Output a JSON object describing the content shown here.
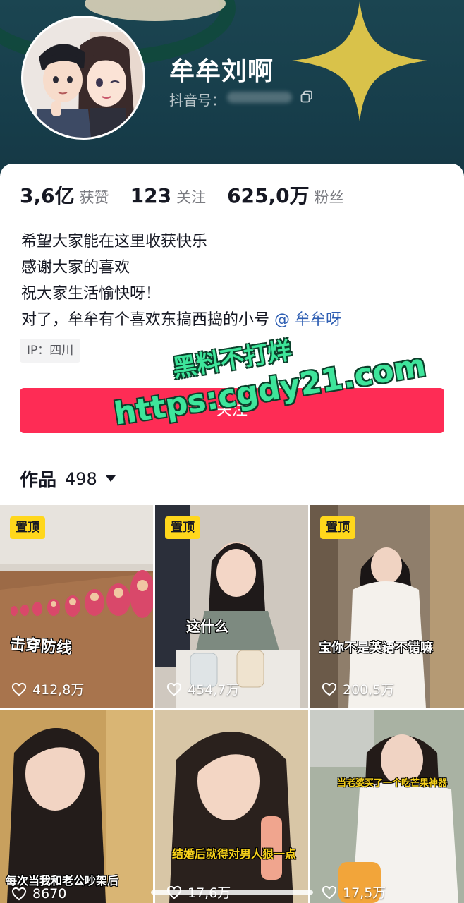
{
  "profile": {
    "nickname": "牟牟刘啊",
    "douyin_id_label": "抖音号："
  },
  "stats": {
    "likes_num": "3,6亿",
    "likes_label": "获赞",
    "following_num": "123",
    "following_label": "关注",
    "followers_num": "625,0万",
    "followers_label": "粉丝"
  },
  "bio": {
    "line1": "希望大家能在这里收获快乐",
    "line2": "感谢大家的喜欢",
    "line3": "祝大家生活愉快呀！",
    "line4": "对了，牟牟有个喜欢东搞西捣的小号 ",
    "mention": "@ 牟牟呀"
  },
  "ip_tag": "IP：四川",
  "follow_button": "关注",
  "watermark": {
    "line1": "黑料不打烊",
    "line2": "https:cgdy21.com"
  },
  "works": {
    "label": "作品",
    "count": "498"
  },
  "videos": [
    {
      "pinned": "置顶",
      "caption": "击穿防线",
      "likes": "412,8万"
    },
    {
      "pinned": "置顶",
      "caption": "这什么",
      "likes": "454,7万"
    },
    {
      "pinned": "置顶",
      "caption": "宝你不是英语不错嘛",
      "likes": "200,5万"
    },
    {
      "caption": "每次当我和老公吵架后",
      "likes": "8670"
    },
    {
      "caption": "结婚后就得对男人狠一点",
      "likes": "17,6万"
    },
    {
      "caption": "当老婆买了一个吃芒果神器",
      "likes": "17,5万"
    }
  ],
  "colors": {
    "accent": "#fe2c55",
    "pin": "#ffd71c",
    "mention": "#2f5fb3",
    "header_bg": "#1b4551"
  }
}
